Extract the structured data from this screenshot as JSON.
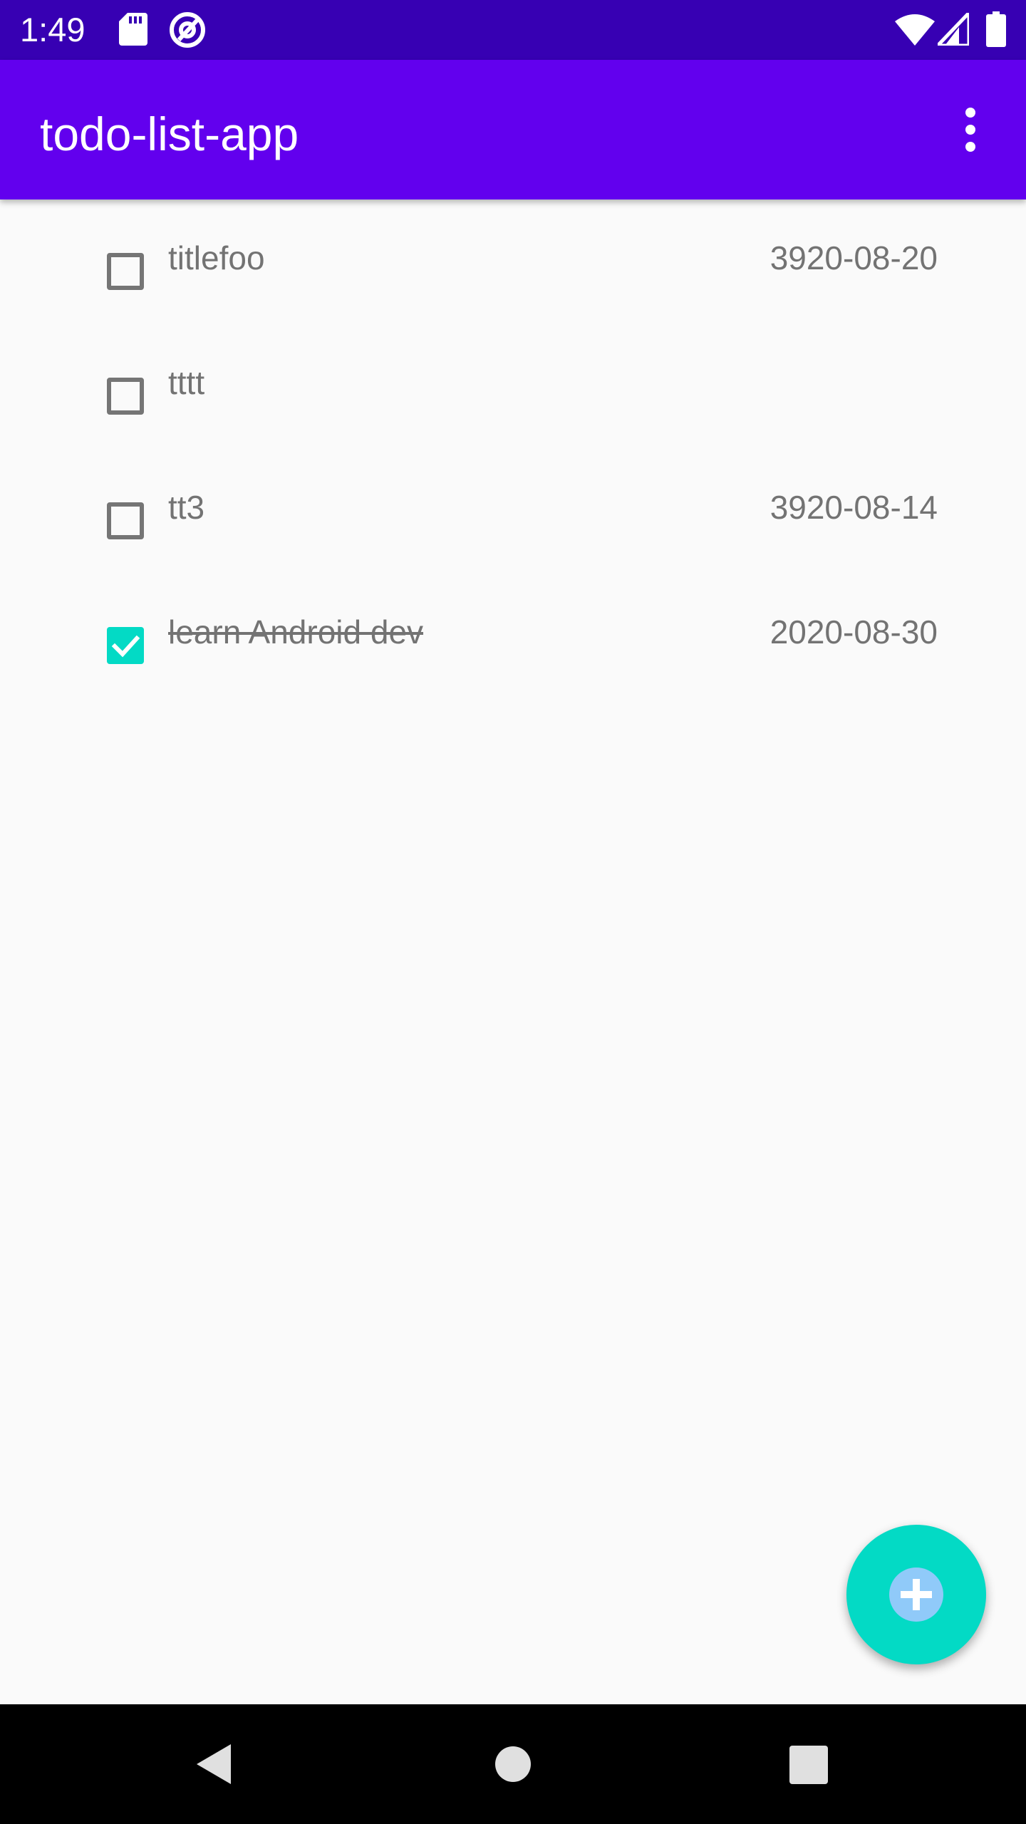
{
  "status_bar": {
    "time": "1:49",
    "icons": [
      "sd-card-icon",
      "at-sign-icon",
      "wifi-icon",
      "cell-signal-icon",
      "battery-icon"
    ]
  },
  "app_bar": {
    "title": "todo-list-app",
    "overflow_icon": "more-vert-icon"
  },
  "todos": [
    {
      "title": "titlefoo",
      "date": "3920-08-20",
      "done": false
    },
    {
      "title": "tttt",
      "date": "",
      "done": false
    },
    {
      "title": "tt3",
      "date": "3920-08-14",
      "done": false
    },
    {
      "title": "learn Android dev",
      "date": "2020-08-30",
      "done": true
    }
  ],
  "fab": {
    "icon": "add-circle-icon"
  },
  "nav_bar": {
    "icons": [
      "back-icon",
      "home-icon",
      "recents-icon"
    ]
  },
  "colors": {
    "status_bar": "#3700b3",
    "app_bar": "#6200ee",
    "accent": "#03dac5",
    "text_secondary": "#737373",
    "background": "#fafafa",
    "fab_plus": "#90caf9"
  }
}
